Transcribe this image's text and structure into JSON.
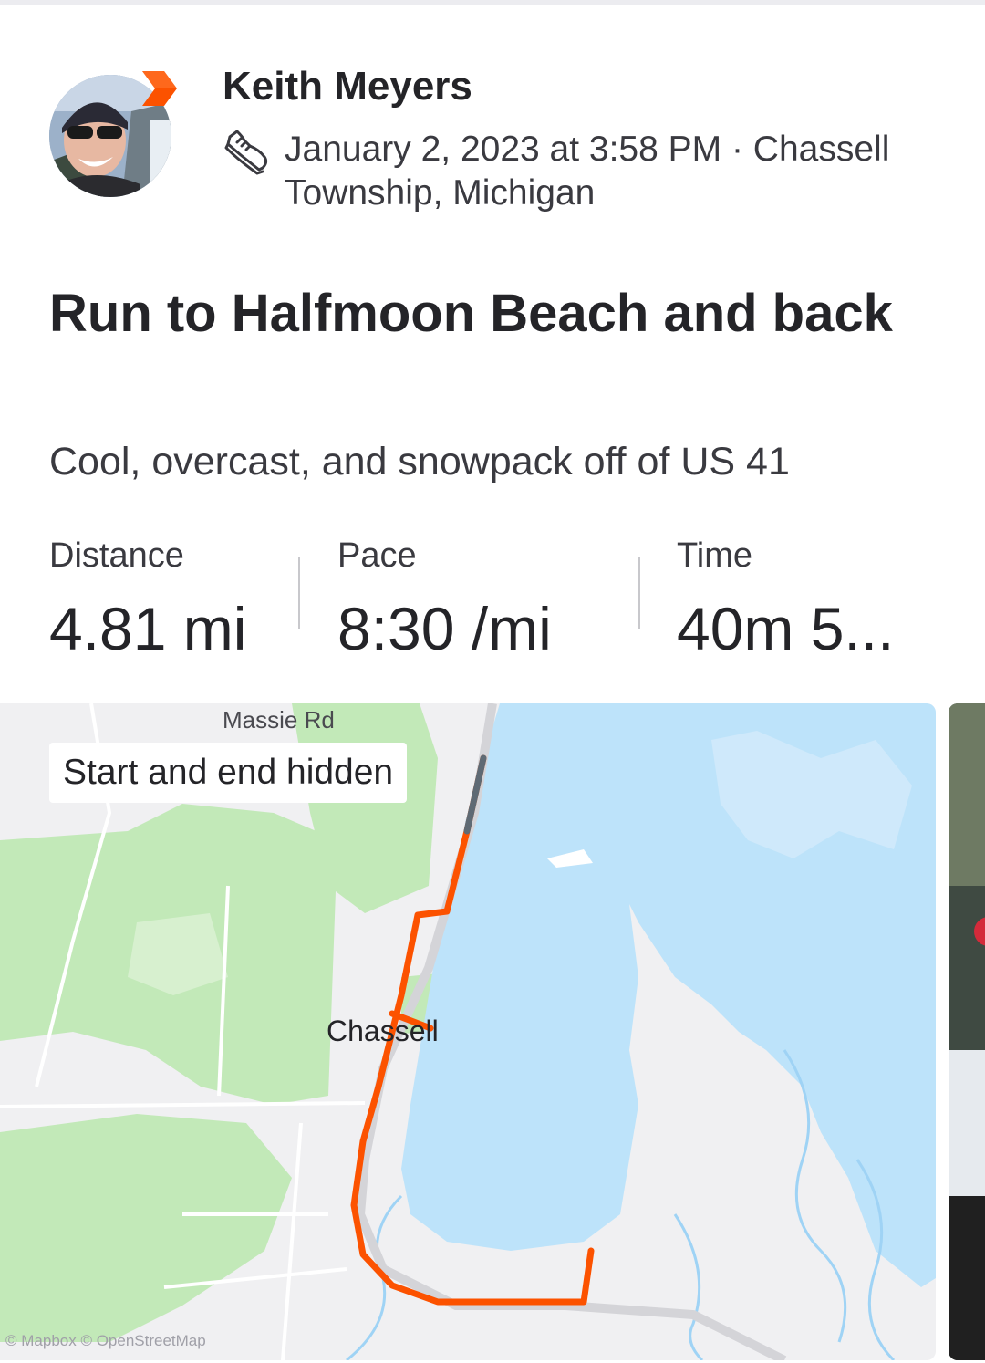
{
  "athlete": {
    "name": "Keith Meyers"
  },
  "activity": {
    "meta": "January 2, 2023 at 3:58 PM · Chassell Township, Michigan",
    "title": "Run to Halfmoon Beach and back",
    "description": "Cool, overcast, and snowpack off of US 41"
  },
  "stats": [
    {
      "label": "Distance",
      "value": "4.81 mi"
    },
    {
      "label": "Pace",
      "value": "8:30 /mi"
    },
    {
      "label": "Time",
      "value": "40m 5..."
    }
  ],
  "map": {
    "privacy_label": "Start and end hidden",
    "road_label": "Massie Rd",
    "town_label": "Chassell",
    "attribution": "© Mapbox © OpenStreetMap"
  },
  "colors": {
    "route": "#fc5200",
    "water": "#bde3fa",
    "land": "#f0f0f2",
    "park": "#bfe8b4",
    "badge": "#fc5200"
  },
  "icons": {
    "activity_type": "shoe-icon",
    "subscriber_badge": "chevron-badge-icon"
  }
}
